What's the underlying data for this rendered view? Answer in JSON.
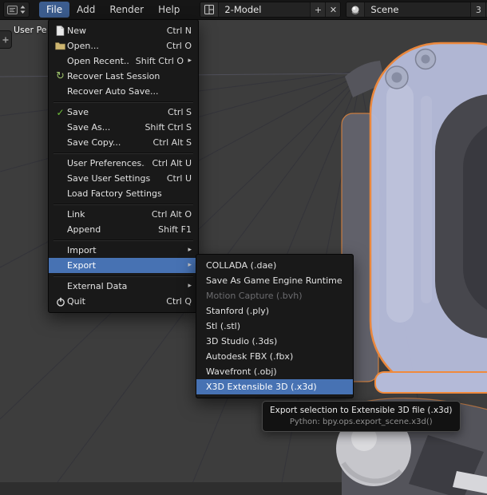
{
  "colors": {
    "accent_highlight": "#4772b3",
    "selection_outline": "#f08a3c",
    "menu_background": "#191919",
    "header_background": "#161616",
    "viewport_background": "#3d3d3d"
  },
  "icons": {
    "submenu_arrow": "▸",
    "check": "✓",
    "recover": "↻"
  },
  "header": {
    "menus": [
      {
        "label": "File"
      },
      {
        "label": "Add"
      },
      {
        "label": "Render"
      },
      {
        "label": "Help"
      }
    ],
    "screen": {
      "value": "2-Model",
      "add_label": "+",
      "close_label": "✕"
    },
    "scene": {
      "value": "Scene",
      "users_count": "3",
      "add_label": "+"
    }
  },
  "viewport": {
    "view_label": "User Pe"
  },
  "file_menu": {
    "items": [
      {
        "label": "New",
        "shortcut": "Ctrl N",
        "icon": "file"
      },
      {
        "label": "Open...",
        "shortcut": "Ctrl O",
        "icon": "folder"
      },
      {
        "label": "Open Recent...",
        "shortcut": "Shift Ctrl O",
        "submenu": true
      },
      {
        "label": "Recover Last Session",
        "icon": "recover"
      },
      {
        "label": "Recover Auto Save..."
      },
      {
        "separator": true
      },
      {
        "label": "Save",
        "shortcut": "Ctrl S",
        "icon": "check"
      },
      {
        "label": "Save As...",
        "shortcut": "Shift Ctrl S"
      },
      {
        "label": "Save Copy...",
        "shortcut": "Ctrl Alt S"
      },
      {
        "separator": true
      },
      {
        "label": "User Preferences...",
        "shortcut": "Ctrl Alt U"
      },
      {
        "label": "Save User Settings",
        "shortcut": "Ctrl U"
      },
      {
        "label": "Load Factory Settings"
      },
      {
        "separator": true
      },
      {
        "label": "Link",
        "shortcut": "Ctrl Alt O"
      },
      {
        "label": "Append",
        "shortcut": "Shift F1"
      },
      {
        "separator": true
      },
      {
        "label": "Import",
        "submenu": true
      },
      {
        "label": "Export",
        "submenu": true,
        "highlighted": true
      },
      {
        "separator": true
      },
      {
        "label": "External Data",
        "submenu": true
      },
      {
        "label": "Quit",
        "shortcut": "Ctrl Q",
        "icon": "power"
      }
    ]
  },
  "export_menu": {
    "items": [
      {
        "label": "COLLADA (.dae)"
      },
      {
        "label": "Save As Game Engine Runtime"
      },
      {
        "label": "Motion Capture (.bvh)",
        "disabled": true
      },
      {
        "label": "Stanford (.ply)"
      },
      {
        "label": "Stl (.stl)"
      },
      {
        "label": "3D Studio (.3ds)"
      },
      {
        "label": "Autodesk FBX (.fbx)"
      },
      {
        "label": "Wavefront (.obj)"
      },
      {
        "label": "X3D Extensible 3D (.x3d)",
        "highlighted": true
      }
    ]
  },
  "tooltip": {
    "title": "Export selection to Extensible 3D file (.x3d)",
    "python": "Python: bpy.ops.export_scene.x3d()"
  }
}
